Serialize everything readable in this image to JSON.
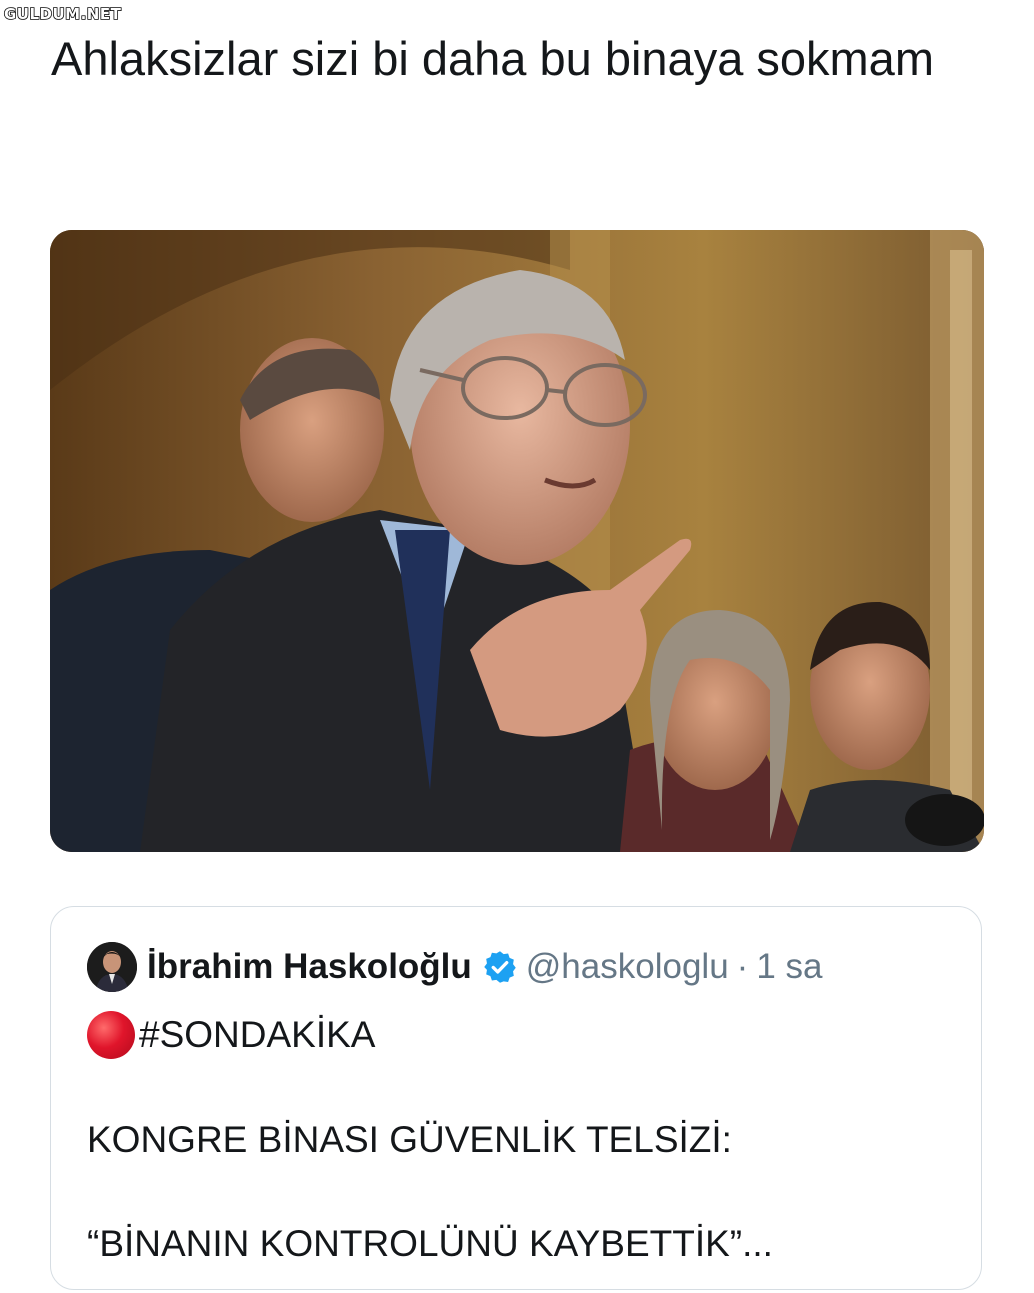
{
  "watermark": "GULDUM.NET",
  "tweet": {
    "text": "Ahlaksizlar sizi bi daha bu binaya sokmam"
  },
  "media": {
    "alt_icon": "press-conference-photo"
  },
  "quoted_tweet": {
    "author_name": "İbrahim Haskoloğlu",
    "handle": "@haskologlu",
    "separator": "·",
    "time": "1 sa",
    "hashtag": "#SONDAKİKA",
    "line2": "KONGRE BİNASI GÜVENLİK TELSİZİ:",
    "line3": "“BİNANIN KONTROLÜNÜ KAYBETTİK”..."
  },
  "colors": {
    "verified": "#1da1f2",
    "secondary_text": "#657786",
    "border": "#d6dde3",
    "red_dot": "#e0152b"
  }
}
